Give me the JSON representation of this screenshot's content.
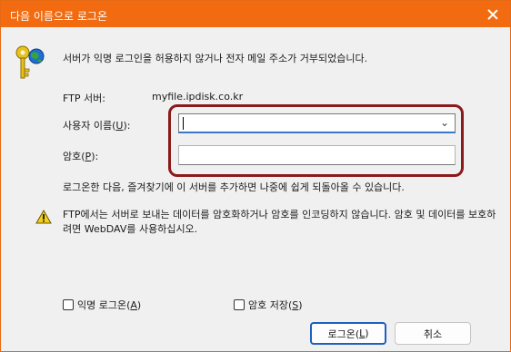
{
  "dialog": {
    "title": "다음 이름으로 로그온",
    "message": "서버가 익명 로그인을 허용하지 않거나 전자 메일 주소가 거부되었습니다."
  },
  "ftp": {
    "label": "FTP 서버:",
    "value": "myfile.ipdisk.co.kr"
  },
  "user": {
    "label_prefix": "사용자 이름(",
    "label_key": "U",
    "label_suffix": "):",
    "value": ""
  },
  "password": {
    "label_prefix": "암호(",
    "label_key": "P",
    "label_suffix": "):",
    "value": ""
  },
  "save_note": "로그온한 다음, 즐겨찾기에 이 서버를 추가하면 나중에 쉽게 되돌아올 수 있습니다.",
  "warning": "FTP에서는 서버로 보내는 데이터를 암호화하거나 암호를 인코딩하지 않습니다. 암호 및 데이터를 보호하려면 WebDAV를 사용하십시오.",
  "options": {
    "anonymous": {
      "prefix": "익명 로그온(",
      "key": "A",
      "suffix": ")",
      "checked": false
    },
    "save_password": {
      "prefix": "암호 저장(",
      "key": "S",
      "suffix": ")",
      "checked": false
    }
  },
  "buttons": {
    "login": {
      "prefix": "로그온(",
      "key": "L",
      "suffix": ")"
    },
    "cancel": "취소"
  },
  "colors": {
    "titlebar": "#f26b10",
    "highlight": "#8b1a1a",
    "focus": "#3b76c7"
  },
  "icons": {
    "key": "key-globe-icon",
    "warning": "warning-icon",
    "close": "close-icon",
    "dropdown": "chevron-down-icon"
  }
}
